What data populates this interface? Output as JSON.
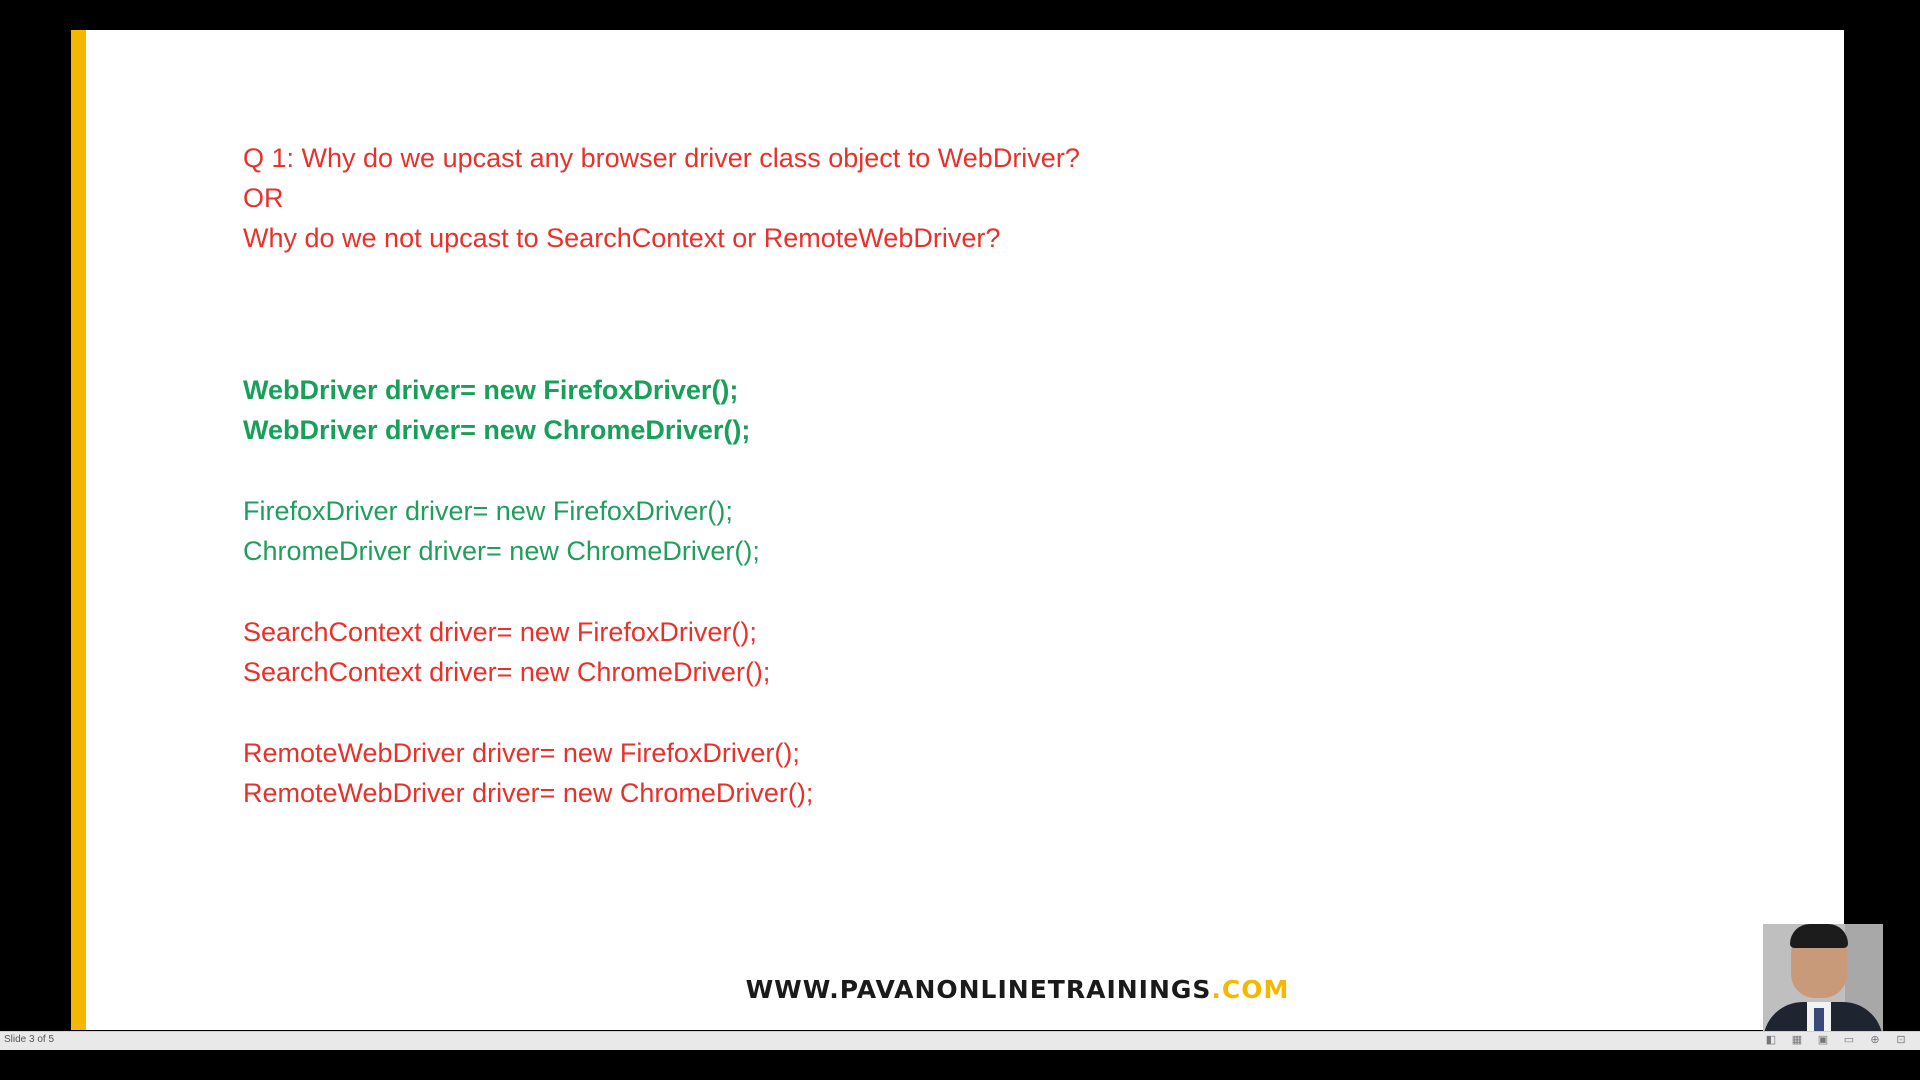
{
  "slide": {
    "question_lines": [
      "Q 1: Why do we upcast any browser driver class object to WebDriver?",
      "OR",
      "Why do we not upcast to SearchContext or RemoteWebDriver?"
    ],
    "webdriver_lines": [
      "WebDriver driver= new FirefoxDriver();",
      "WebDriver driver= new ChromeDriver();"
    ],
    "concrete_lines": [
      "FirefoxDriver driver= new FirefoxDriver();",
      "ChromeDriver driver= new ChromeDriver();"
    ],
    "searchcontext_lines": [
      "SearchContext driver= new FirefoxDriver();",
      "SearchContext driver= new ChromeDriver();"
    ],
    "remote_lines": [
      "RemoteWebDriver driver= new FirefoxDriver();",
      "RemoteWebDriver driver= new ChromeDriver();"
    ],
    "watermark_main": "WWW.PAVANONLINETRAININGS",
    "watermark_suffix": ".COM"
  },
  "status_bar": {
    "slide_indicator": "Slide 3 of 5"
  },
  "icons": {
    "status": [
      "normal-view-icon",
      "slide-sorter-icon",
      "reading-view-icon",
      "slideshow-icon",
      "zoom-icon",
      "fit-icon"
    ]
  },
  "colors": {
    "question": "#e8312a",
    "correct_code": "#17a05a",
    "alt_code_green": "#1f9e5c",
    "incorrect_code": "#e8312a",
    "accent_bar": "#f5b800",
    "watermark_suffix": "#f5b800"
  }
}
